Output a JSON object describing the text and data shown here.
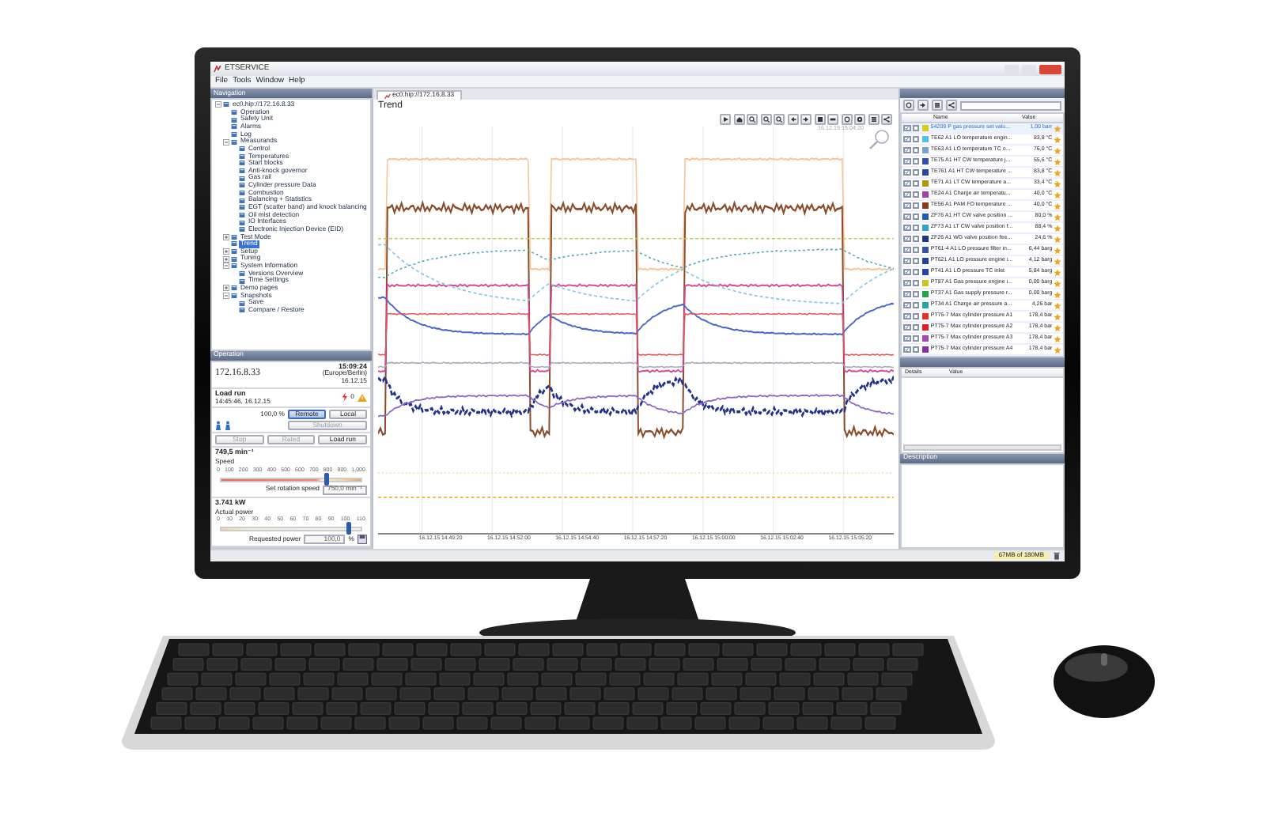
{
  "window": {
    "title": "ETSERVICE"
  },
  "menu": [
    "File",
    "Tools",
    "Window",
    "Help"
  ],
  "navigation": {
    "title": "Navigation",
    "tree": [
      {
        "label": "ec0.hip://172.16.8.33",
        "expanded": true,
        "selected": false,
        "children": [
          {
            "label": "Operation",
            "selected": false
          },
          {
            "label": "Safety Unit",
            "selected": false
          },
          {
            "label": "Alarms",
            "selected": false
          },
          {
            "label": "Log",
            "selected": false
          },
          {
            "label": "Measurands",
            "expanded": true,
            "selected": false,
            "children": [
              {
                "label": "Control",
                "selected": false
              },
              {
                "label": "Temperatures",
                "selected": false
              },
              {
                "label": "Start blocks",
                "selected": false
              },
              {
                "label": "Anti-knock governor",
                "selected": false
              },
              {
                "label": "Gas rail",
                "selected": false
              },
              {
                "label": "Cylinder pressure Data",
                "selected": false
              },
              {
                "label": "Combustion",
                "selected": false
              },
              {
                "label": "Balancing + Statistics",
                "selected": false
              },
              {
                "label": "EGT (scatter band) and knock balancing",
                "selected": false
              },
              {
                "label": "Oil mist detection",
                "selected": false
              },
              {
                "label": "IO Interfaces",
                "selected": false
              },
              {
                "label": "Electronic Injection Device (EID)",
                "selected": false
              }
            ]
          },
          {
            "label": "Test Mode",
            "expanded": false,
            "selected": false
          },
          {
            "label": "Trend",
            "selected": true
          },
          {
            "label": "Setup",
            "expanded": false,
            "selected": false
          },
          {
            "label": "Tuning",
            "expanded": false,
            "selected": false
          },
          {
            "label": "System Information",
            "expanded": true,
            "selected": false,
            "children": [
              {
                "label": "Versions Overview",
                "selected": false
              },
              {
                "label": "Time Settings",
                "selected": false
              }
            ]
          },
          {
            "label": "Demo pages",
            "expanded": false,
            "selected": false
          },
          {
            "label": "Snapshots",
            "expanded": true,
            "selected": false,
            "children": [
              {
                "label": "Save",
                "selected": false
              },
              {
                "label": "Compare / Restore",
                "selected": false
              }
            ]
          }
        ]
      }
    ]
  },
  "operation": {
    "title": "Operation",
    "address": "172.16.8.33",
    "time": "15:09:24",
    "timezone": "(Europe/Berlin)",
    "date": "16.12.15",
    "mode": "Load run",
    "mode_since": "14:45:46, 16.12.15",
    "alarm_count": "0",
    "load": "100,0 %",
    "buttons": [
      {
        "label": "Remote",
        "selected": true,
        "disabled": false
      },
      {
        "label": "Local",
        "selected": false,
        "disabled": false
      }
    ],
    "shutdown": {
      "label": "Shutdown",
      "disabled": true
    },
    "actions": [
      {
        "label": "Stop",
        "disabled": true
      },
      {
        "label": "Rated",
        "disabled": true
      },
      {
        "label": "Load run",
        "disabled": false
      }
    ],
    "speed": {
      "reading": "749,5 min⁻¹",
      "label": "Speed",
      "scale": [
        "0",
        "100",
        "200",
        "300",
        "400",
        "500",
        "600",
        "700",
        "800",
        "900",
        "1,000"
      ],
      "level": 0.75,
      "setpoint_label": "Set rotation speed",
      "setpoint": "750,0 min⁻¹"
    },
    "power": {
      "reading": "3.741 kW",
      "label": "Actual power",
      "scale": [
        "0",
        "10",
        "20",
        "30",
        "40",
        "50",
        "60",
        "70",
        "80",
        "90",
        "100",
        "110"
      ],
      "level": 0.91,
      "request_label": "Requested power",
      "request": "100,0",
      "unit": "%"
    }
  },
  "trend": {
    "tab": "ec0.hip://172.16.8.33",
    "title": "Trend",
    "timestamp": "16.12.15 15:04:20",
    "x_labels": [
      "16.12.15 14:49:20",
      "16.12.15 14:52:00",
      "16.12.15 14:54:40",
      "16.12.15 14:57:20",
      "16.12.15 15:00:00",
      "16.12.15 15:02:40",
      "16.12.15 15:05:20"
    ]
  },
  "signals": {
    "columns": [
      "Name",
      "Value"
    ],
    "rows": [
      {
        "name": "54209 P gas pressure set valu...",
        "value": "1,00 barr",
        "color": "#d8cc20",
        "checked": true,
        "checked_2": false,
        "selected": true
      },
      {
        "name": "TE62 A1 LO temperature engin...",
        "value": "83,8 °C",
        "color": "#48c4e4",
        "checked": true,
        "checked_2": false,
        "selected": false
      },
      {
        "name": "TE63 A1 LO temperature TC o...",
        "value": "76,0 °C",
        "color": "#7aa0d0",
        "checked": true,
        "checked_2": false,
        "selected": false
      },
      {
        "name": "TE75 A1 HT CW temperature j...",
        "value": "55,6 °C",
        "color": "#3050b0",
        "checked": true,
        "checked_2": false,
        "selected": false
      },
      {
        "name": "TE761 A1 HT CW temperature ...",
        "value": "83,8 °C",
        "color": "#2848a0",
        "checked": true,
        "checked_2": false,
        "selected": false
      },
      {
        "name": "TE71 A1 LT CW temperature a...",
        "value": "33,4 °C",
        "color": "#b8960c",
        "checked": true,
        "checked_2": false,
        "selected": false
      },
      {
        "name": "TE24 A1 Charge air temperatu...",
        "value": "40,0 °C",
        "color": "#a040a8",
        "checked": true,
        "checked_2": false,
        "selected": false
      },
      {
        "name": "TE56 A1 PAM FO temperature ...",
        "value": "40,0 °C",
        "color": "#8a3c1c",
        "checked": true,
        "checked_2": false,
        "selected": false
      },
      {
        "name": "ZF76 A1 HT CW valve position ...",
        "value": "80,0 %",
        "color": "#2458b8",
        "checked": true,
        "checked_2": false,
        "selected": false
      },
      {
        "name": "ZF73 A1 LT CW valve position f...",
        "value": "88,4 %",
        "color": "#30a4c4",
        "checked": true,
        "checked_2": false,
        "selected": false
      },
      {
        "name": "ZF26 A1 WG valve position fee...",
        "value": "24,6 %",
        "color": "#203488",
        "checked": true,
        "checked_2": false,
        "selected": false
      },
      {
        "name": "PT61-4 A1 LO pressure filter in...",
        "value": "6,44 barg",
        "color": "#3454a4",
        "checked": true,
        "checked_2": false,
        "selected": false
      },
      {
        "name": "PT621 A1 LO pressure engine i...",
        "value": "4,12 barg",
        "color": "#204494",
        "checked": true,
        "checked_2": false,
        "selected": false
      },
      {
        "name": "PT41 A1 LO pressure TC inlet",
        "value": "5,84 barg",
        "color": "#2844a8",
        "checked": true,
        "checked_2": false,
        "selected": false
      },
      {
        "name": "PT87 A1 Gas pressure engine i...",
        "value": "0,00 barg",
        "color": "#ccc424",
        "checked": true,
        "checked_2": false,
        "selected": false
      },
      {
        "name": "PT37 A1 Gas supply pressure r...",
        "value": "0,00 barg",
        "color": "#24a444",
        "checked": true,
        "checked_2": false,
        "selected": false
      },
      {
        "name": "PT34 A1 Charge air pressure a...",
        "value": "4,26 bar",
        "color": "#24a4a4",
        "checked": true,
        "checked_2": false,
        "selected": false
      },
      {
        "name": "PT75-7 Max cylinder pressure A1",
        "value": "178,4 bar",
        "color": "#e43424",
        "checked": true,
        "checked_2": false,
        "selected": false
      },
      {
        "name": "PT75-7 Max cylinder pressure A2",
        "value": "178,4 bar",
        "color": "#e02020",
        "checked": true,
        "checked_2": false,
        "selected": false
      },
      {
        "name": "PT75-7 Max cylinder pressure A3",
        "value": "178,4 bar",
        "color": "#a844b4",
        "checked": true,
        "checked_2": false,
        "selected": false
      },
      {
        "name": "PT75-7 Max cylinder pressure A4",
        "value": "178,4 bar",
        "color": "#8430a4",
        "checked": true,
        "checked_2": false,
        "selected": false
      }
    ]
  },
  "details": {
    "columns": [
      "Details",
      "Value"
    ]
  },
  "description": {
    "title": "Description"
  },
  "status_bar": {
    "memory": "67MB of 180MB"
  }
}
